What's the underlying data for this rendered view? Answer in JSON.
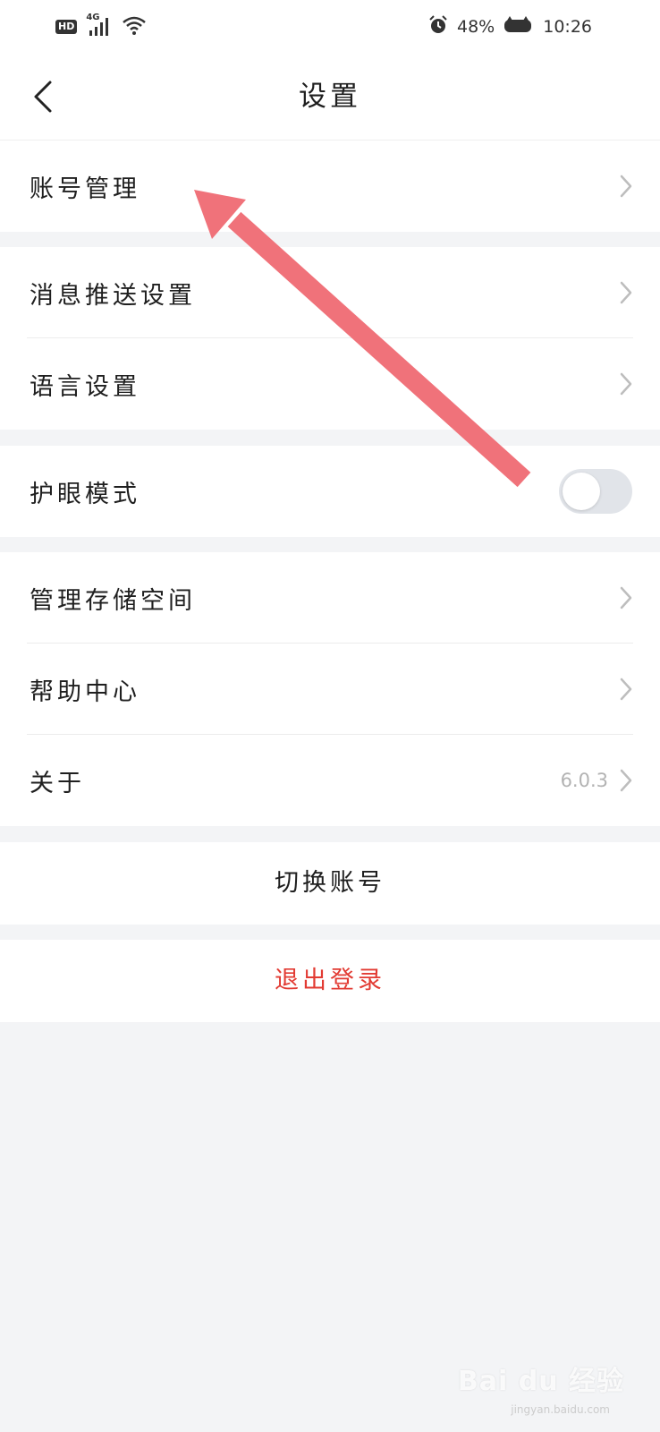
{
  "status_bar": {
    "network": "4G",
    "hd_badge": "HD",
    "battery": "48%",
    "time": "10:26",
    "icons": [
      "signal-icon",
      "wifi-icon",
      "alarm-icon",
      "battery-icon"
    ]
  },
  "header": {
    "title": "设置",
    "back_icon": "back-chevron-icon"
  },
  "settings": {
    "account_management": "账号管理",
    "push_settings": "消息推送设置",
    "language_settings": "语言设置",
    "eye_protection": "护眼模式",
    "eye_protection_enabled": false,
    "storage_management": "管理存储空间",
    "help_center": "帮助中心",
    "about": "关于",
    "version": "6.0.3"
  },
  "actions": {
    "switch_account": "切换账号",
    "logout": "退出登录"
  },
  "colors": {
    "accent_red": "#e23b33",
    "annotation_arrow": "#f0727a",
    "page_bg": "#f3f4f6",
    "toggle_off": "#e1e4e9"
  },
  "watermark": {
    "brand": "Bai du 经验",
    "url": "jingyan.baidu.com"
  }
}
